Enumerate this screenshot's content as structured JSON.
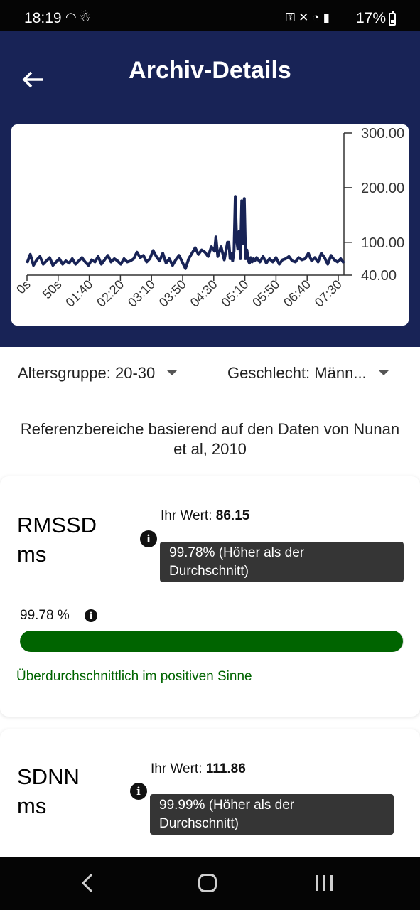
{
  "status_bar": {
    "time": "18:19",
    "battery": "17%",
    "left_icons": [
      "hotspot-icon",
      "snowman-icon"
    ],
    "right_icons": [
      "key-icon",
      "mute-icon",
      "wifi-icon",
      "wifi-call-icon",
      "signal-icon",
      "signal-icon",
      "battery-icon"
    ]
  },
  "header": {
    "title": "Archiv-Details",
    "back_icon": "arrow-left-icon"
  },
  "chart_data": {
    "type": "line",
    "x_ticks": [
      "0s",
      "50s",
      "01:40",
      "02:20",
      "03:10",
      "03:50",
      "04:30",
      "05:10",
      "05:50",
      "06:40",
      "07:30"
    ],
    "y_ticks": [
      "300.00",
      "200.00",
      "100.00",
      "40.00"
    ],
    "ylim": [
      40,
      300
    ],
    "y_axis_side": "right",
    "line_color": "#182356",
    "series": [
      {
        "x": [
          0,
          5,
          10,
          15,
          20,
          25,
          30,
          35,
          40,
          45,
          50,
          55,
          60,
          65,
          70,
          75,
          80,
          85,
          90,
          95,
          100,
          105,
          110,
          115,
          120,
          125,
          130,
          135,
          140,
          145,
          150,
          155,
          160,
          165,
          170,
          175,
          180,
          185,
          190,
          195,
          200,
          205,
          210,
          215,
          220,
          225,
          230,
          235,
          240,
          245,
          250,
          255,
          260,
          265,
          270,
          275,
          280,
          285,
          290,
          292,
          295,
          300,
          305,
          310,
          312,
          314,
          316,
          318,
          320,
          322,
          324,
          326,
          328,
          330,
          332,
          334,
          336,
          338,
          340,
          342,
          344,
          346,
          348,
          350,
          352,
          355,
          360,
          365,
          370,
          375,
          380,
          385,
          390,
          395,
          400,
          405,
          410,
          415,
          420,
          425,
          430,
          435,
          440,
          445,
          450,
          455,
          460,
          465,
          470,
          475,
          480,
          485,
          490
        ],
        "values": [
          62,
          78,
          58,
          68,
          74,
          60,
          66,
          72,
          58,
          64,
          70,
          60,
          66,
          62,
          70,
          60,
          66,
          72,
          64,
          58,
          68,
          64,
          74,
          60,
          68,
          76,
          64,
          70,
          66,
          60,
          70,
          64,
          66,
          70,
          82,
          72,
          76,
          64,
          70,
          85,
          74,
          66,
          80,
          62,
          70,
          58,
          68,
          76,
          64,
          52,
          70,
          80,
          90,
          78,
          86,
          82,
          74,
          92,
          84,
          110,
          74,
          92,
          68,
          100,
          100,
          70,
          80,
          66,
          84,
          184,
          106,
          88,
          120,
          70,
          176,
          98,
          180,
          70,
          86,
          66,
          62,
          72,
          64,
          70,
          66,
          72,
          64,
          74,
          62,
          70,
          64,
          72,
          60,
          68,
          70,
          74,
          66,
          64,
          72,
          68,
          70,
          80,
          66,
          72,
          64,
          80,
          72,
          60,
          76,
          68,
          64,
          70,
          62
        ]
      }
    ]
  },
  "filters": {
    "age_label": "Altersgruppe:",
    "age_value": "20-30",
    "gender_label": "Geschlecht:",
    "gender_value": "Männ..."
  },
  "reference_text": {
    "line1": "Referenzbereiche basierend auf den Daten von Nunan",
    "line2": "et al, 2010"
  },
  "metrics": [
    {
      "name_line1": "RMSSD",
      "name_line2": "ms",
      "value_label": "Ihr Wert:",
      "value": "86.15",
      "tooltip_line1": "99.78% (Höher als der",
      "tooltip_line2": "Durchschnitt)",
      "percent_label": "99.78 %",
      "progress_fraction": 0.9978,
      "status_text": "Überdurchschnittlich im positiven Sinne",
      "accent_color": "#006400"
    },
    {
      "name_line1": "SDNN",
      "name_line2": "ms",
      "value_label": "Ihr Wert:",
      "value": "111.86",
      "tooltip_line1": "99.99% (Höher als der",
      "tooltip_line2": "Durchschnitt)"
    }
  ],
  "nav_bar": {
    "back_icon": "nav-back-icon",
    "home_icon": "nav-home-icon",
    "recent_icon": "nav-recent-apps-icon"
  }
}
